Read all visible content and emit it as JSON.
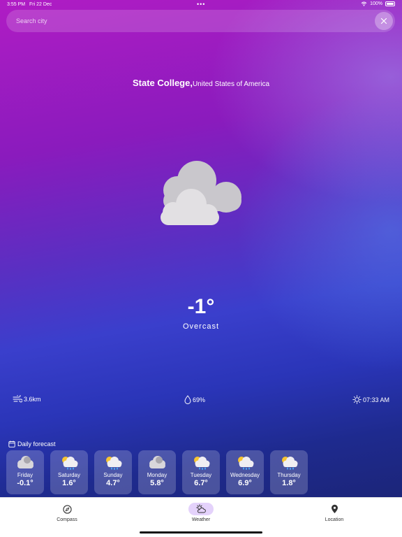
{
  "status": {
    "time": "3:55 PM",
    "date": "Fri 22 Dec",
    "battery": "100%"
  },
  "search": {
    "placeholder": "Search city"
  },
  "location": {
    "city": "State College,",
    "country": "United States of America"
  },
  "current": {
    "temperature": "-1°",
    "condition": "Overcast",
    "icon": "overcast-cloud-icon"
  },
  "stats": {
    "wind": "3.6km",
    "humidity": "69%",
    "sunrise": "07:33 AM"
  },
  "forecast": {
    "title": "Daily forecast",
    "days": [
      {
        "name": "Friday",
        "temp": "-0.1°",
        "icon": "cloud-icon"
      },
      {
        "name": "Saturday",
        "temp": "1.6°",
        "icon": "sun-cloud-rain-icon"
      },
      {
        "name": "Sunday",
        "temp": "4.7°",
        "icon": "sun-cloud-rain-icon"
      },
      {
        "name": "Monday",
        "temp": "5.8°",
        "icon": "cloud-icon"
      },
      {
        "name": "Tuesday",
        "temp": "6.7°",
        "icon": "sun-cloud-rain-icon"
      },
      {
        "name": "Wednesday",
        "temp": "6.9°",
        "icon": "sun-cloud-rain-icon"
      },
      {
        "name": "Thursday",
        "temp": "1.8°",
        "icon": "sun-cloud-rain-icon"
      }
    ]
  },
  "tabs": {
    "compass": "Compass",
    "weather": "Weather",
    "location": "Location",
    "active": "weather"
  },
  "colors": {
    "tab_active_bg": "#e4d2fb",
    "card_bg": "rgba(255,255,255,0.2)"
  }
}
